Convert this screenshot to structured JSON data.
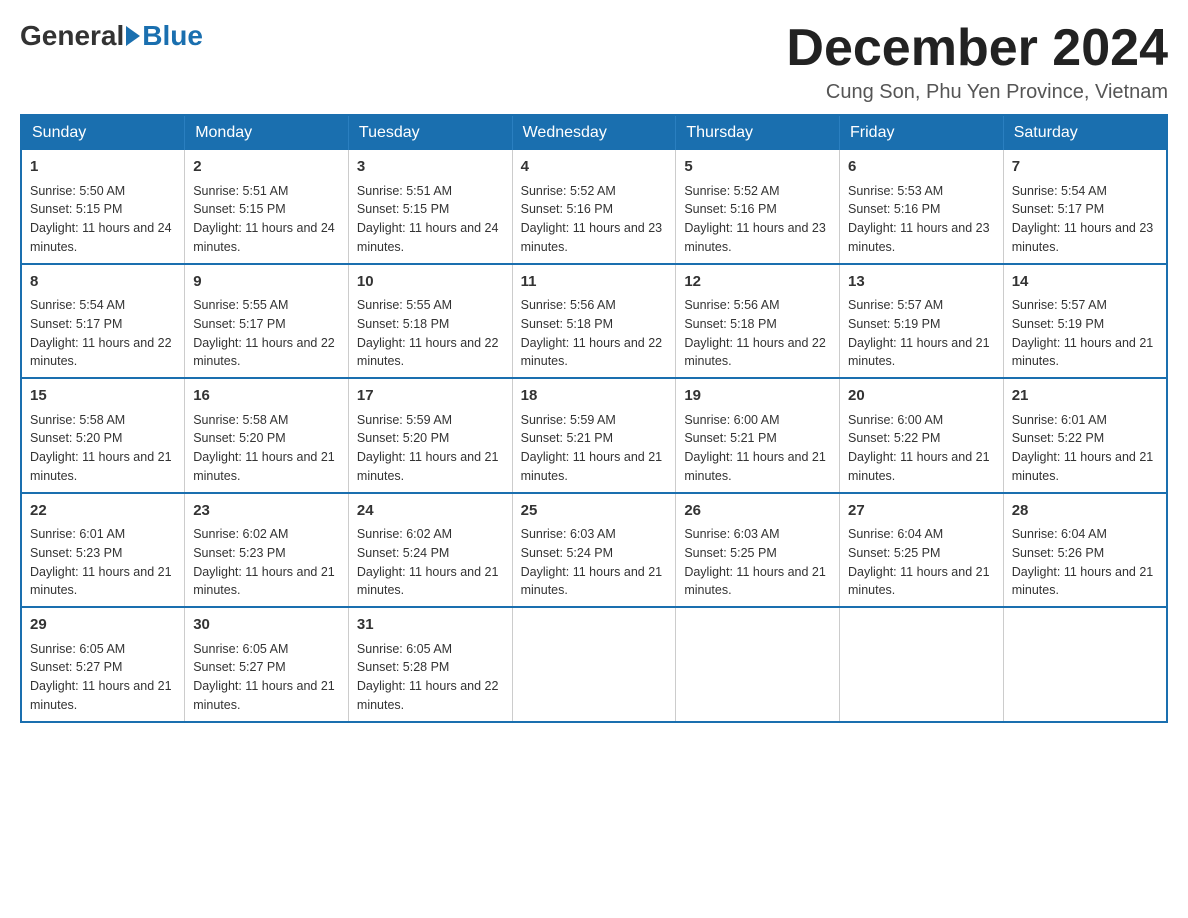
{
  "header": {
    "logo": {
      "general": "General",
      "blue": "Blue"
    },
    "title": "December 2024",
    "location": "Cung Son, Phu Yen Province, Vietnam"
  },
  "weekdays": [
    "Sunday",
    "Monday",
    "Tuesday",
    "Wednesday",
    "Thursday",
    "Friday",
    "Saturday"
  ],
  "weeks": [
    [
      {
        "day": "1",
        "sunrise": "Sunrise: 5:50 AM",
        "sunset": "Sunset: 5:15 PM",
        "daylight": "Daylight: 11 hours and 24 minutes."
      },
      {
        "day": "2",
        "sunrise": "Sunrise: 5:51 AM",
        "sunset": "Sunset: 5:15 PM",
        "daylight": "Daylight: 11 hours and 24 minutes."
      },
      {
        "day": "3",
        "sunrise": "Sunrise: 5:51 AM",
        "sunset": "Sunset: 5:15 PM",
        "daylight": "Daylight: 11 hours and 24 minutes."
      },
      {
        "day": "4",
        "sunrise": "Sunrise: 5:52 AM",
        "sunset": "Sunset: 5:16 PM",
        "daylight": "Daylight: 11 hours and 23 minutes."
      },
      {
        "day": "5",
        "sunrise": "Sunrise: 5:52 AM",
        "sunset": "Sunset: 5:16 PM",
        "daylight": "Daylight: 11 hours and 23 minutes."
      },
      {
        "day": "6",
        "sunrise": "Sunrise: 5:53 AM",
        "sunset": "Sunset: 5:16 PM",
        "daylight": "Daylight: 11 hours and 23 minutes."
      },
      {
        "day": "7",
        "sunrise": "Sunrise: 5:54 AM",
        "sunset": "Sunset: 5:17 PM",
        "daylight": "Daylight: 11 hours and 23 minutes."
      }
    ],
    [
      {
        "day": "8",
        "sunrise": "Sunrise: 5:54 AM",
        "sunset": "Sunset: 5:17 PM",
        "daylight": "Daylight: 11 hours and 22 minutes."
      },
      {
        "day": "9",
        "sunrise": "Sunrise: 5:55 AM",
        "sunset": "Sunset: 5:17 PM",
        "daylight": "Daylight: 11 hours and 22 minutes."
      },
      {
        "day": "10",
        "sunrise": "Sunrise: 5:55 AM",
        "sunset": "Sunset: 5:18 PM",
        "daylight": "Daylight: 11 hours and 22 minutes."
      },
      {
        "day": "11",
        "sunrise": "Sunrise: 5:56 AM",
        "sunset": "Sunset: 5:18 PM",
        "daylight": "Daylight: 11 hours and 22 minutes."
      },
      {
        "day": "12",
        "sunrise": "Sunrise: 5:56 AM",
        "sunset": "Sunset: 5:18 PM",
        "daylight": "Daylight: 11 hours and 22 minutes."
      },
      {
        "day": "13",
        "sunrise": "Sunrise: 5:57 AM",
        "sunset": "Sunset: 5:19 PM",
        "daylight": "Daylight: 11 hours and 21 minutes."
      },
      {
        "day": "14",
        "sunrise": "Sunrise: 5:57 AM",
        "sunset": "Sunset: 5:19 PM",
        "daylight": "Daylight: 11 hours and 21 minutes."
      }
    ],
    [
      {
        "day": "15",
        "sunrise": "Sunrise: 5:58 AM",
        "sunset": "Sunset: 5:20 PM",
        "daylight": "Daylight: 11 hours and 21 minutes."
      },
      {
        "day": "16",
        "sunrise": "Sunrise: 5:58 AM",
        "sunset": "Sunset: 5:20 PM",
        "daylight": "Daylight: 11 hours and 21 minutes."
      },
      {
        "day": "17",
        "sunrise": "Sunrise: 5:59 AM",
        "sunset": "Sunset: 5:20 PM",
        "daylight": "Daylight: 11 hours and 21 minutes."
      },
      {
        "day": "18",
        "sunrise": "Sunrise: 5:59 AM",
        "sunset": "Sunset: 5:21 PM",
        "daylight": "Daylight: 11 hours and 21 minutes."
      },
      {
        "day": "19",
        "sunrise": "Sunrise: 6:00 AM",
        "sunset": "Sunset: 5:21 PM",
        "daylight": "Daylight: 11 hours and 21 minutes."
      },
      {
        "day": "20",
        "sunrise": "Sunrise: 6:00 AM",
        "sunset": "Sunset: 5:22 PM",
        "daylight": "Daylight: 11 hours and 21 minutes."
      },
      {
        "day": "21",
        "sunrise": "Sunrise: 6:01 AM",
        "sunset": "Sunset: 5:22 PM",
        "daylight": "Daylight: 11 hours and 21 minutes."
      }
    ],
    [
      {
        "day": "22",
        "sunrise": "Sunrise: 6:01 AM",
        "sunset": "Sunset: 5:23 PM",
        "daylight": "Daylight: 11 hours and 21 minutes."
      },
      {
        "day": "23",
        "sunrise": "Sunrise: 6:02 AM",
        "sunset": "Sunset: 5:23 PM",
        "daylight": "Daylight: 11 hours and 21 minutes."
      },
      {
        "day": "24",
        "sunrise": "Sunrise: 6:02 AM",
        "sunset": "Sunset: 5:24 PM",
        "daylight": "Daylight: 11 hours and 21 minutes."
      },
      {
        "day": "25",
        "sunrise": "Sunrise: 6:03 AM",
        "sunset": "Sunset: 5:24 PM",
        "daylight": "Daylight: 11 hours and 21 minutes."
      },
      {
        "day": "26",
        "sunrise": "Sunrise: 6:03 AM",
        "sunset": "Sunset: 5:25 PM",
        "daylight": "Daylight: 11 hours and 21 minutes."
      },
      {
        "day": "27",
        "sunrise": "Sunrise: 6:04 AM",
        "sunset": "Sunset: 5:25 PM",
        "daylight": "Daylight: 11 hours and 21 minutes."
      },
      {
        "day": "28",
        "sunrise": "Sunrise: 6:04 AM",
        "sunset": "Sunset: 5:26 PM",
        "daylight": "Daylight: 11 hours and 21 minutes."
      }
    ],
    [
      {
        "day": "29",
        "sunrise": "Sunrise: 6:05 AM",
        "sunset": "Sunset: 5:27 PM",
        "daylight": "Daylight: 11 hours and 21 minutes."
      },
      {
        "day": "30",
        "sunrise": "Sunrise: 6:05 AM",
        "sunset": "Sunset: 5:27 PM",
        "daylight": "Daylight: 11 hours and 21 minutes."
      },
      {
        "day": "31",
        "sunrise": "Sunrise: 6:05 AM",
        "sunset": "Sunset: 5:28 PM",
        "daylight": "Daylight: 11 hours and 22 minutes."
      },
      null,
      null,
      null,
      null
    ]
  ]
}
